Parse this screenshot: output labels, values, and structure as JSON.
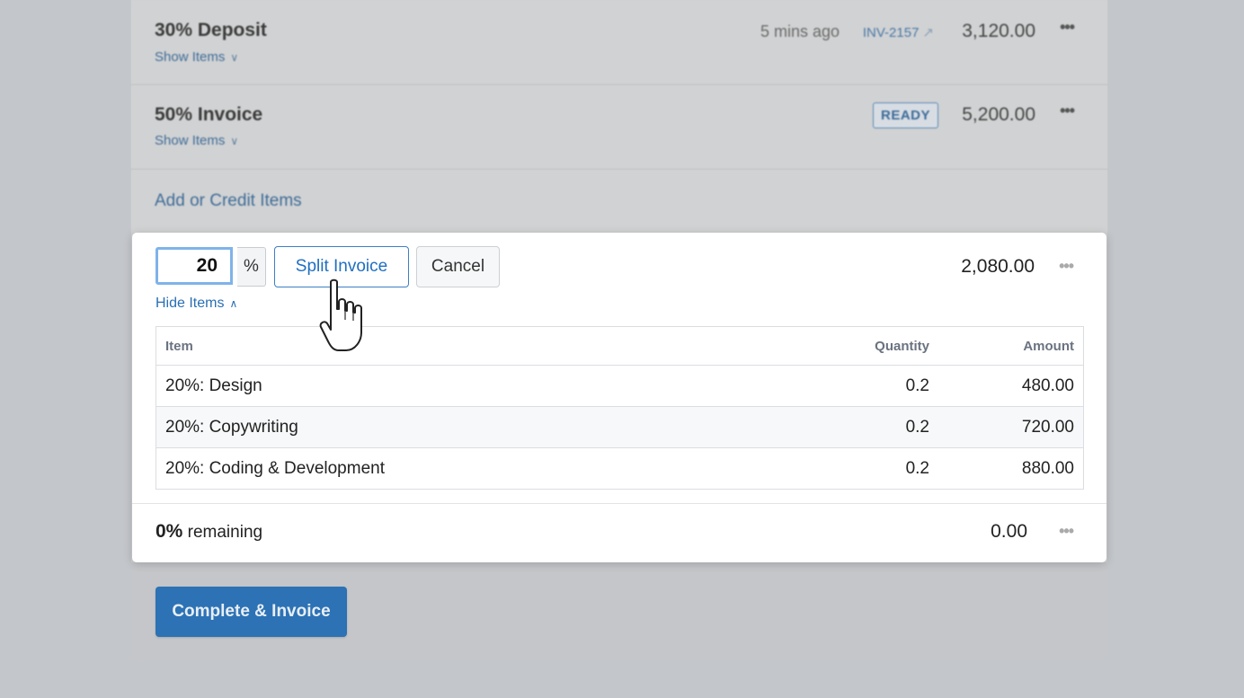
{
  "rows": [
    {
      "title": "30% Deposit",
      "show_items": "Show Items",
      "time": "5 mins ago",
      "invoice_link": "INV-2157",
      "amount": "3,120.00"
    },
    {
      "title": "50% Invoice",
      "show_items": "Show Items",
      "badge": "READY",
      "amount": "5,200.00"
    }
  ],
  "add_credit_label": "Add or Credit Items",
  "split": {
    "percent_value": "20",
    "percent_symbol": "%",
    "split_button": "Split Invoice",
    "cancel_button": "Cancel",
    "amount": "2,080.00",
    "hide_items": "Hide Items",
    "table": {
      "headers": {
        "item": "Item",
        "quantity": "Quantity",
        "amount": "Amount"
      },
      "rows": [
        {
          "item": "20%: Design",
          "quantity": "0.2",
          "amount": "480.00"
        },
        {
          "item": "20%: Copywriting",
          "quantity": "0.2",
          "amount": "720.00"
        },
        {
          "item": "20%: Coding & Development",
          "quantity": "0.2",
          "amount": "880.00"
        }
      ]
    }
  },
  "remaining": {
    "percent": "0%",
    "label": "remaining",
    "amount": "0.00"
  },
  "complete_button": "Complete & Invoice",
  "icons": {
    "more": "more-dots-icon",
    "external": "external-link-icon",
    "chevron": "chevron-icon",
    "cursor": "hand-pointer-icon"
  }
}
